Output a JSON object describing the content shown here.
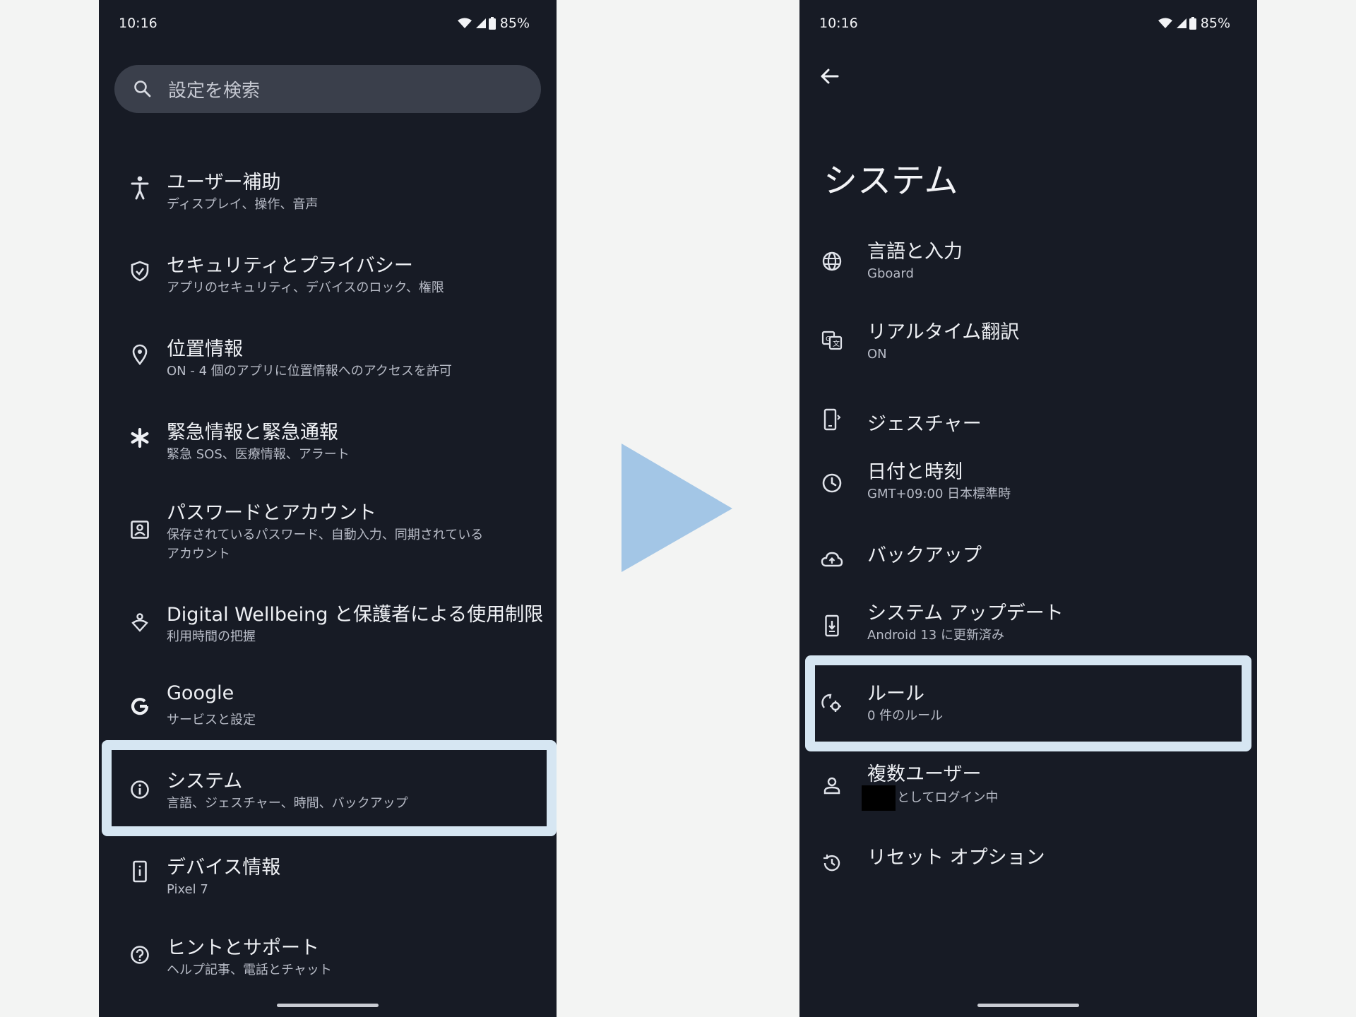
{
  "left": {
    "status": {
      "time": "10:16",
      "battery": "85%"
    },
    "search": {
      "placeholder": "設定を検索"
    },
    "items": [
      {
        "title": "ユーザー補助",
        "sub": "ディスプレイ、操作、音声",
        "icon": "accessibility-icon"
      },
      {
        "title": "セキュリティとプライバシー",
        "sub": "アプリのセキュリティ、デバイスのロック、権限",
        "icon": "shield-check-icon"
      },
      {
        "title": "位置情報",
        "sub": "ON - 4 個のアプリに位置情報へのアクセスを許可",
        "icon": "location-pin-icon"
      },
      {
        "title": "緊急情報と緊急通報",
        "sub": "緊急 SOS、医療情報、アラート",
        "icon": "asterisk-icon"
      },
      {
        "title": "パスワードとアカウント",
        "sub": "保存されているパスワード、自動入力、同期されている",
        "sub2": "アカウント",
        "icon": "account-box-icon"
      },
      {
        "title": "Digital Wellbeing と保護者による使用制限",
        "sub": "利用時間の把握",
        "icon": "wellbeing-icon"
      },
      {
        "title": "Google",
        "sub": "サービスと設定",
        "icon": "google-g-icon"
      },
      {
        "title": "システム",
        "sub": "言語、ジェスチャー、時間、バックアップ",
        "icon": "info-circle-icon"
      },
      {
        "title": "デバイス情報",
        "sub": "Pixel 7",
        "icon": "phone-info-icon"
      },
      {
        "title": "ヒントとサポート",
        "sub": "ヘルプ記事、電話とチャット",
        "icon": "help-circle-icon"
      }
    ]
  },
  "right": {
    "status": {
      "time": "10:16",
      "battery": "85%"
    },
    "page_title": "システム",
    "items": [
      {
        "title": "言語と入力",
        "sub": "Gboard",
        "icon": "globe-icon"
      },
      {
        "title": "リアルタイム翻訳",
        "sub": "ON",
        "icon": "translate-icon"
      },
      {
        "title": "ジェスチャー",
        "sub": "",
        "icon": "gesture-phone-icon"
      },
      {
        "title": "日付と時刻",
        "sub": "GMT+09:00 日本標準時",
        "icon": "clock-icon"
      },
      {
        "title": "バックアップ",
        "sub": "",
        "icon": "cloud-upload-icon"
      },
      {
        "title": "システム アップデート",
        "sub": "Android 13 に更新済み",
        "icon": "system-update-icon"
      },
      {
        "title": "ルール",
        "sub": "0 件のルール",
        "icon": "rules-icon"
      },
      {
        "title": "複数ユーザー",
        "sub": "としてログイン中",
        "icon": "person-icon"
      },
      {
        "title": "リセット オプション",
        "sub": "",
        "icon": "history-icon"
      }
    ]
  },
  "colors": {
    "background": "#f3f4f3",
    "phone": "#171b25",
    "highlight": "#d6e6f2",
    "arrow": "#a3c6e6",
    "search": "#3a3f4b"
  }
}
